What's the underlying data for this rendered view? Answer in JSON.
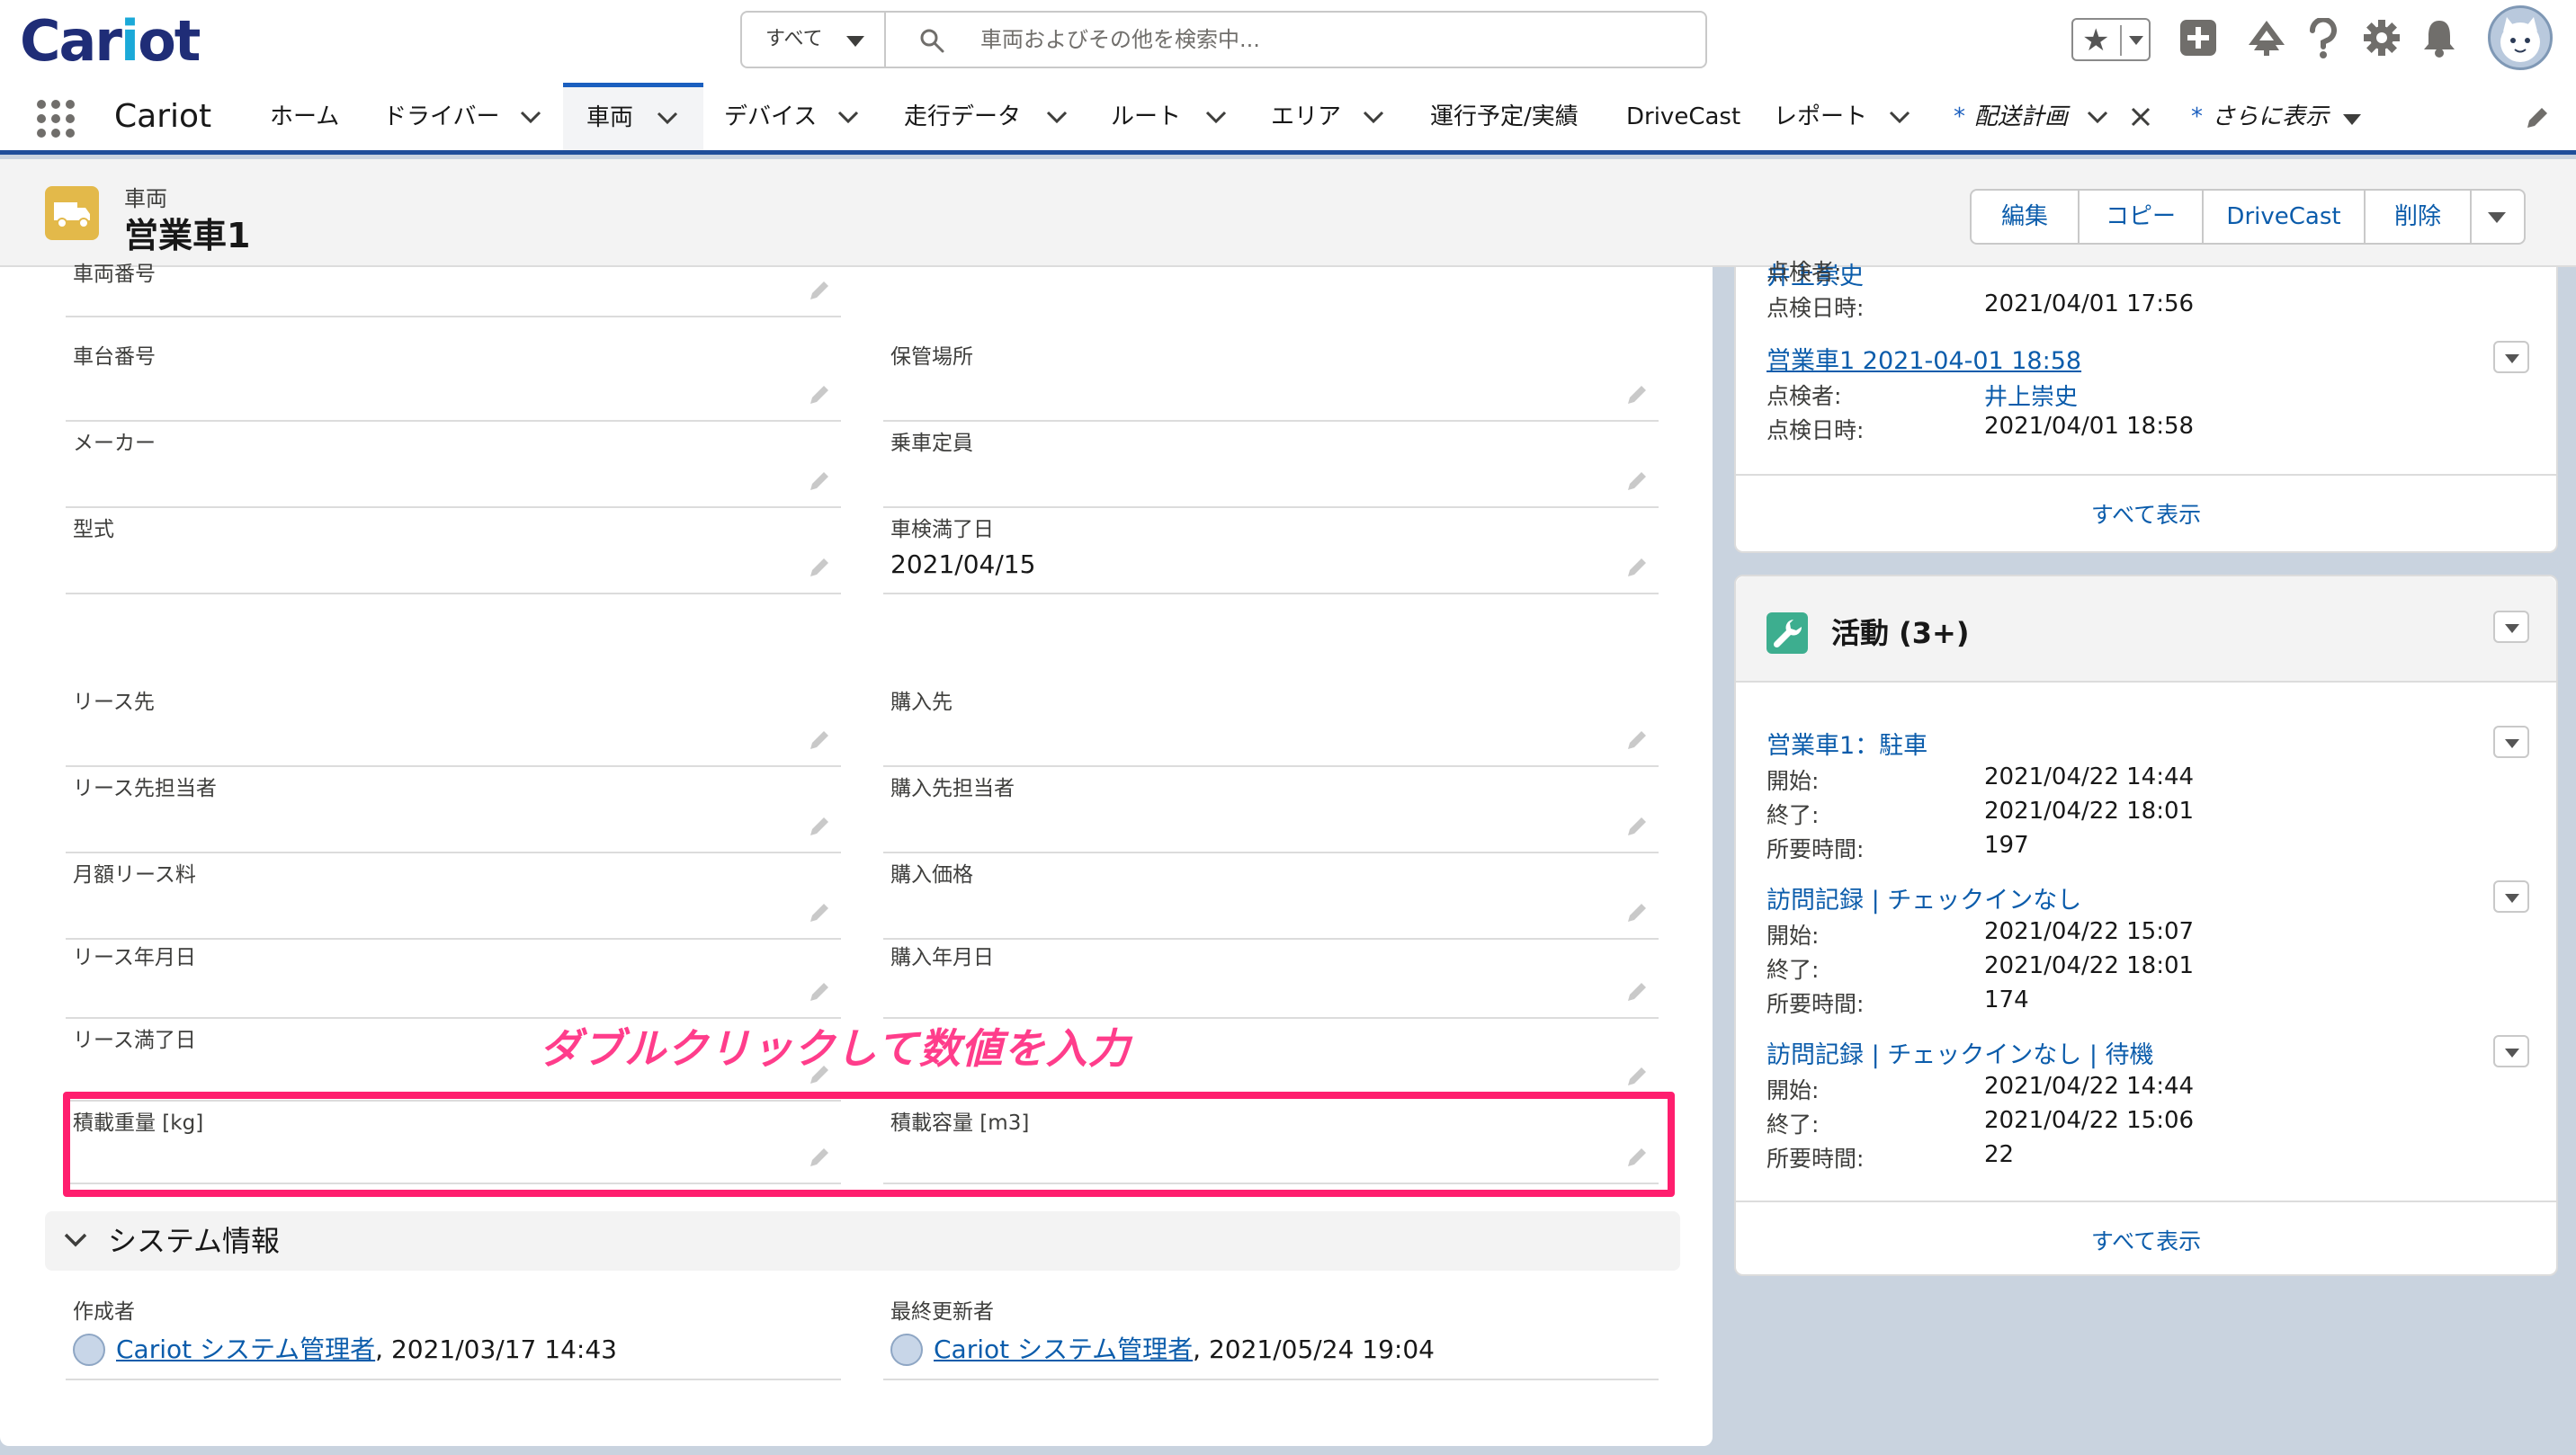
{
  "app": {
    "logo_main": "Car",
    "logo_i": "i",
    "logo_rest": "ot",
    "name": "Cariot"
  },
  "search": {
    "scope": "すべて",
    "placeholder": "車両およびその他を検索中..."
  },
  "header_icons": [
    "star-icon",
    "add-icon",
    "trailhead-icon",
    "help-icon",
    "setup-gear-icon",
    "notification-bell-icon",
    "user-avatar"
  ],
  "nav": {
    "tabs": [
      {
        "label": "ホーム",
        "dropdown": false
      },
      {
        "label": "ドライバー",
        "dropdown": true
      },
      {
        "label": "車両",
        "dropdown": true,
        "active": true
      },
      {
        "label": "デバイス",
        "dropdown": true
      },
      {
        "label": "走行データ",
        "dropdown": true
      },
      {
        "label": "ルート",
        "dropdown": true
      },
      {
        "label": "エリア",
        "dropdown": true
      },
      {
        "label": "運行予定/実績",
        "dropdown": false
      },
      {
        "label": "DriveCast",
        "dropdown": false
      },
      {
        "label": "レポート",
        "dropdown": true
      },
      {
        "label": "配送計画",
        "dropdown": true,
        "closable": true,
        "italic": true,
        "mark": "*"
      },
      {
        "label": "さらに表示",
        "dropdown": true,
        "italic": true,
        "mark": "*"
      }
    ]
  },
  "record": {
    "object_label": "車両",
    "name": "営業車1",
    "actions": [
      "編集",
      "コピー",
      "DriveCast",
      "削除"
    ]
  },
  "fields": {
    "left": [
      {
        "label": "車両番号",
        "value": ""
      },
      {
        "label": "車台番号",
        "value": ""
      },
      {
        "label": "メーカー",
        "value": ""
      },
      {
        "label": "型式",
        "value": ""
      },
      {
        "label": "リース先",
        "value": ""
      },
      {
        "label": "リース先担当者",
        "value": ""
      },
      {
        "label": "月額リース料",
        "value": ""
      },
      {
        "label": "リース年月日",
        "value": ""
      },
      {
        "label": "リース満了日",
        "value": ""
      },
      {
        "label": "積載重量 [kg]",
        "value": ""
      }
    ],
    "right": [
      {
        "label": "保管場所",
        "value": ""
      },
      {
        "label": "乗車定員",
        "value": ""
      },
      {
        "label": "車検満了日",
        "value": "2021/04/15"
      },
      {
        "label": "購入先",
        "value": ""
      },
      {
        "label": "購入先担当者",
        "value": ""
      },
      {
        "label": "購入価格",
        "value": ""
      },
      {
        "label": "購入年月日",
        "value": ""
      },
      {
        "label": "積載容量 [m3]",
        "value": ""
      }
    ]
  },
  "annotation": "ダブルクリックして数値を入力",
  "system": {
    "section_title": "システム情報",
    "created_by_label": "作成者",
    "created_by_user": "Cariot システム管理者",
    "created_at": ", 2021/03/17 14:43",
    "modified_by_label": "最終更新者",
    "modified_by_user": "Cariot システム管理者",
    "modified_at": ", 2021/05/24 19:04"
  },
  "inspections": {
    "partial_label": "点検者:",
    "partial_inspector": "井上崇史",
    "partial_date_label": "点検日時:",
    "partial_date": "2021/04/01 17:56",
    "item_title": "営業車1 2021-04-01 18:58",
    "item_inspector_label": "点検者:",
    "item_inspector": "井上崇史",
    "item_date_label": "点検日時:",
    "item_date": "2021/04/01 18:58",
    "view_all": "すべて表示"
  },
  "activities": {
    "title": "活動 (3+)",
    "items": [
      {
        "title": "営業車1：駐車",
        "start_label": "開始:",
        "start": "2021/04/22 14:44",
        "end_label": "終了:",
        "end": "2021/04/22 18:01",
        "duration_label": "所要時間:",
        "duration": "197"
      },
      {
        "title": "訪問記録 | チェックインなし",
        "start_label": "開始:",
        "start": "2021/04/22 15:07",
        "end_label": "終了:",
        "end": "2021/04/22 18:01",
        "duration_label": "所要時間:",
        "duration": "174"
      },
      {
        "title": "訪問記録 | チェックインなし | 待機",
        "start_label": "開始:",
        "start": "2021/04/22 14:44",
        "end_label": "終了:",
        "end": "2021/04/22 15:06",
        "duration_label": "所要時間:",
        "duration": "22"
      }
    ],
    "view_all": "すべて表示"
  },
  "colors": {
    "brand_blue": "#1b5fbf",
    "link": "#0b5cab",
    "highlight": "#ff1e6e",
    "annotation_text": "#ff3d8b",
    "record_icon": "#e3b94a",
    "activity_icon": "#3dae8f"
  }
}
